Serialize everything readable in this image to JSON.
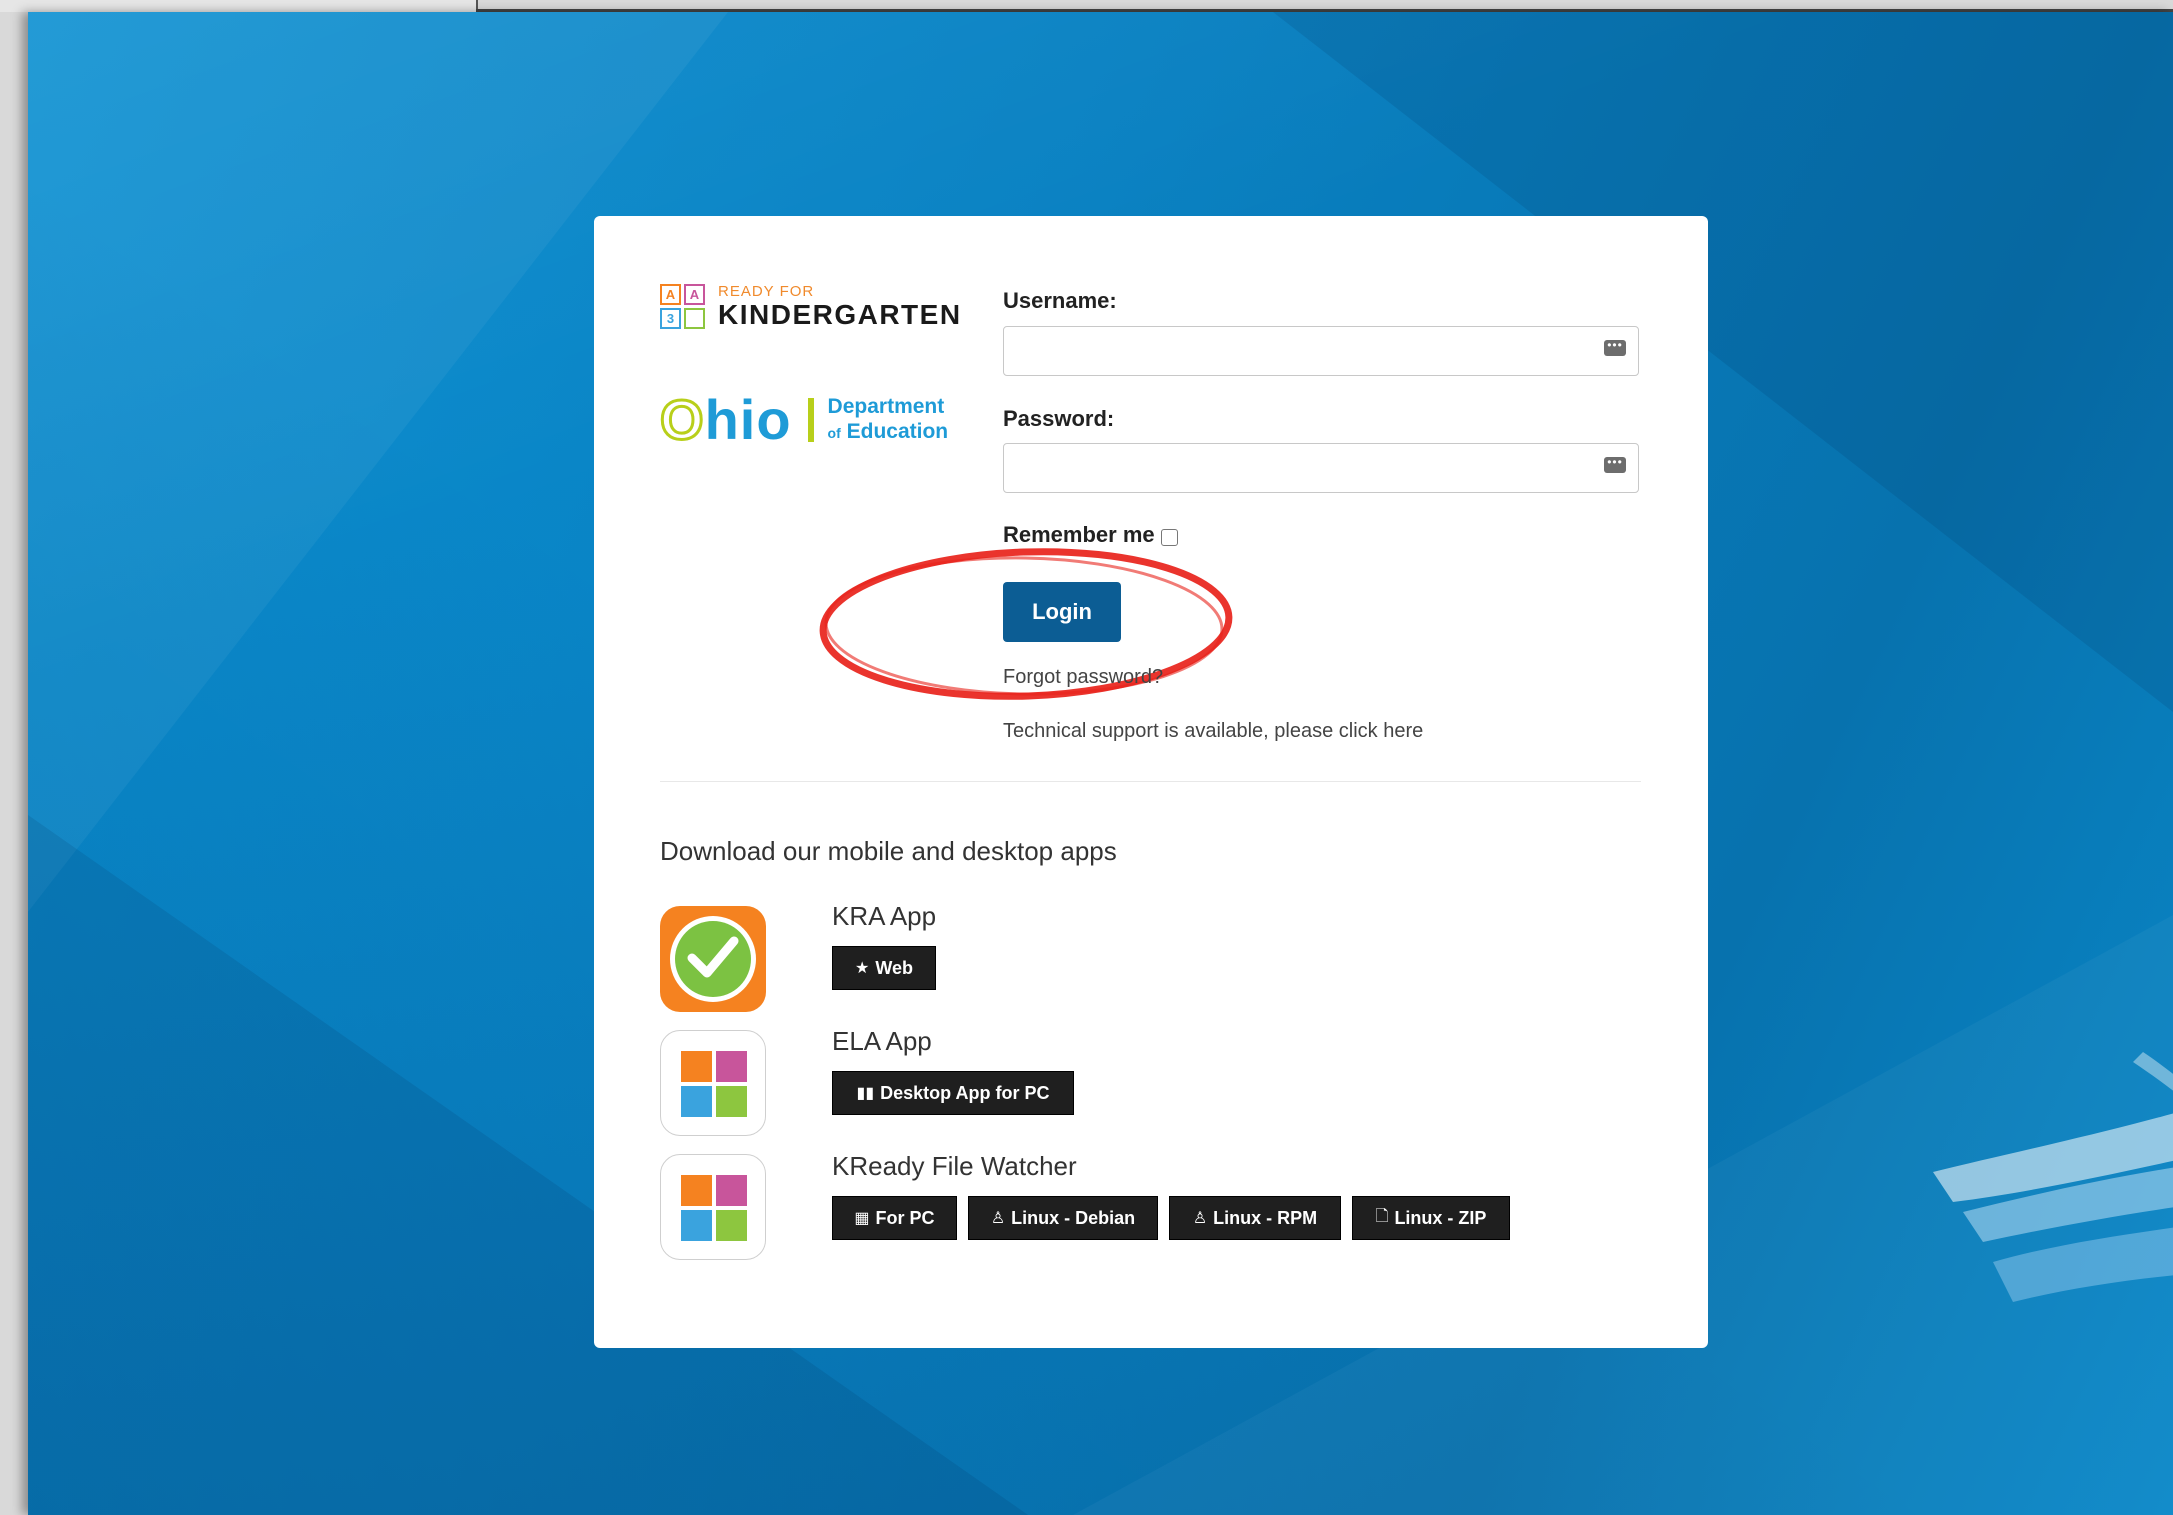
{
  "logos": {
    "kindergarten_small": "READY FOR",
    "kindergarten_big": "KINDERGARTEN",
    "block_letters": [
      "A",
      "A",
      "3",
      ""
    ],
    "ohio_word": "Ohio",
    "ohio_dept_line1": "Department",
    "ohio_dept_of": "of",
    "ohio_dept_line2": "Education"
  },
  "form": {
    "username_label": "Username:",
    "username_value": "",
    "password_label": "Password:",
    "password_value": "",
    "remember_label": "Remember me",
    "remember_checked": false,
    "login_label": "Login",
    "forgot_label": "Forgot password?",
    "support_text": "Technical support is available, please click here"
  },
  "downloads": {
    "title": "Download our mobile and desktop apps",
    "apps": [
      {
        "name": "KRA App",
        "icon": "kra-check-icon",
        "buttons": [
          {
            "icon": "★",
            "label": "Web"
          }
        ]
      },
      {
        "name": "ELA App",
        "icon": "windows-tiles-icon",
        "buttons": [
          {
            "icon": "▮▮",
            "label": "Desktop App for PC"
          }
        ]
      },
      {
        "name": "KReady File Watcher",
        "icon": "windows-tiles-icon",
        "buttons": [
          {
            "icon": "▦",
            "label": "For PC"
          },
          {
            "icon": "♙",
            "label": "Linux - Debian"
          },
          {
            "icon": "♙",
            "label": "Linux - RPM"
          },
          {
            "icon": "🗋",
            "label": "Linux - ZIP"
          }
        ]
      }
    ]
  },
  "colors": {
    "primary_button": "#0c5d94",
    "desktop_blue": "#0981c2",
    "annotation_red": "#e8231b",
    "tile_orange": "#f58220",
    "tile_magenta": "#c8559b",
    "tile_blue": "#3aa3de",
    "tile_green": "#8dc63f"
  }
}
